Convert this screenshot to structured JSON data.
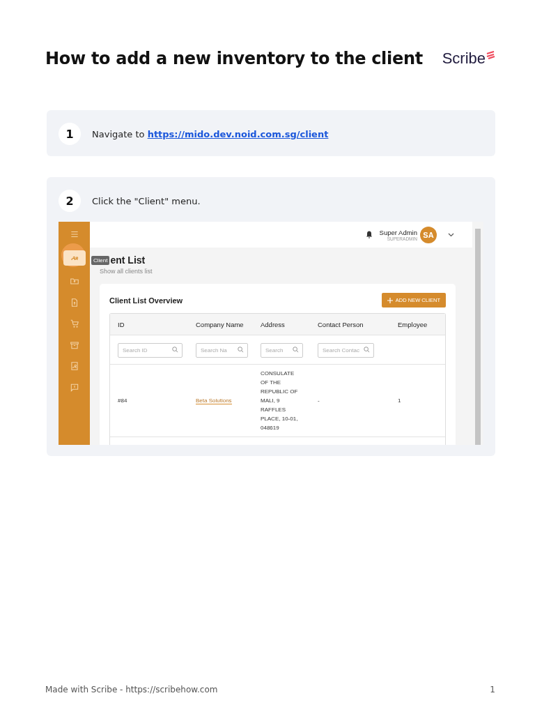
{
  "title": "How to add a new inventory to the client",
  "logo": "Scribe",
  "steps": [
    {
      "number": "1",
      "text": "Navigate to ",
      "link": "https://mido.dev.noid.com.sg/client"
    },
    {
      "number": "2",
      "text": "Click the \"Client\" menu.",
      "screenshot": {
        "sidebar": [
          {
            "selected": false
          },
          {
            "selected": true
          },
          {
            "selected": false
          },
          {
            "selected": false
          },
          {
            "selected": false
          },
          {
            "selected": false
          },
          {
            "selected": false
          },
          {
            "selected": false
          }
        ],
        "tooltip": "Client",
        "user": {
          "name": "Super Admin",
          "role": "SUPERADMIN",
          "initials": "SA"
        },
        "page_title": "ent List",
        "page_subtitle": "Show all clients list",
        "card_title": "Client List Overview",
        "add_button": "ADD NEW CLIENT",
        "columns": [
          "ID",
          "Company Name",
          "Address",
          "Contact Person",
          "Employee"
        ],
        "filters": [
          {
            "placeholder": "Search ID"
          },
          {
            "placeholder": "Search Na"
          },
          {
            "placeholder": "Search"
          },
          {
            "placeholder": "Search Contac"
          }
        ],
        "rows": [
          {
            "id": "#84",
            "company": "Beta Solutions",
            "address": "CONSULATE OF THE REPUBLIC OF MALI, 9 RAFFLES PLACE, 10-01, 048619",
            "contact": "-",
            "employee": "1"
          }
        ]
      }
    }
  ],
  "footer": {
    "text": "Made with Scribe - https://scribehow.com",
    "page": "1"
  }
}
